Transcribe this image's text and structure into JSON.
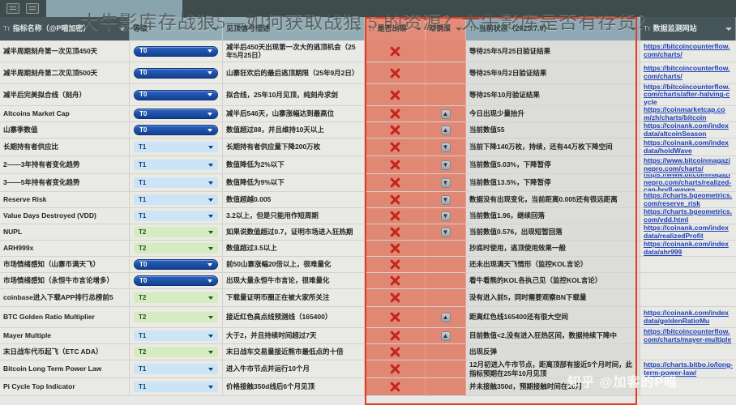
{
  "overlay_title": "大牛影库存战狼5—如何获取战狼 5 的资源？大牛影库是否有存货？",
  "watermark": "知乎 @加客的P喵",
  "toolbar": {
    "icon1": "table-icon",
    "icon2": "table-icon"
  },
  "header": [
    {
      "label": "指标名称（@P喵加密）",
      "type_glyph": "Tт"
    },
    {
      "label": "等级",
      "type_glyph": ""
    },
    {
      "label": "见顶信号描述",
      "type_glyph": ""
    },
    {
      "label": "是否出现",
      "type_glyph": "Tт"
    },
    {
      "label": "动销深",
      "type_glyph": ""
    },
    {
      "label": "当前状态（2025.7.9）",
      "type_glyph": "Tт"
    },
    {
      "label": "数据监测网站",
      "type_glyph": "Tт"
    }
  ],
  "rows": [
    {
      "name": "减半周期刻舟第一次见顶450天",
      "tier": "T0",
      "desc": "减半后450天出现第一次大的逃顶机会（25年5月25日）",
      "signal": "x",
      "trend": "",
      "current": "等待25年5月25日验证结果",
      "url": "https://bitcoincounterflow.com/charts/"
    },
    {
      "name": "减半周期刻舟第二次见顶500天",
      "tier": "T0",
      "desc": "山寨狂欢后的最后逃顶期限（25年9月2日）",
      "signal": "x",
      "trend": "",
      "current": "等待25年9月2日验证结果",
      "url": "https://bitcoincounterflow.com/charts/"
    },
    {
      "name": "减半后完美拟合线（刻舟）",
      "tier": "T0",
      "desc": "拟合线，25年10月见顶，纯刻舟求剑",
      "signal": "x",
      "trend": "",
      "current": "等待25年10月验证结果",
      "url": "https://bitcoincounterflow.com/charts/after-halving-cycle"
    },
    {
      "name": "Altcoins Market Cap",
      "tier": "T0",
      "desc": "减半后546天，山寨涨幅达到最高位",
      "signal": "x",
      "trend": "up",
      "current": "今日出现少量抬升",
      "url": "https://coinmarketcap.com/zh/charts/bitcoin"
    },
    {
      "name": "山寨季数值",
      "tier": "T0",
      "desc": "数值超过88，并且维持10天以上",
      "signal": "x",
      "trend": "up",
      "current": "当前数值55",
      "url": "https://coinank.com/indexdata/altcoinSeason"
    },
    {
      "name": "长期持有者供应比",
      "tier": "T1",
      "desc": "长期持有者供应量下降200万枚",
      "signal": "x",
      "trend": "down",
      "current": "当前下降140万枚，持续，还有44万枚下降空间",
      "url": "https://coinank.com/indexdata/holdWave"
    },
    {
      "name": "2——3年持有者变化趋势",
      "tier": "T1",
      "desc": "数值降低为2%以下",
      "signal": "x",
      "trend": "down",
      "current": "当前数值5.03%，下降暂停",
      "url": "https://www.bitcoinmagazinepro.com/charts/"
    },
    {
      "name": "3——5年持有者变化趋势",
      "tier": "T1",
      "desc": "数值降低为9%以下",
      "signal": "x",
      "trend": "down",
      "current": "当前数值13.5%，下降暂停",
      "url": "https://www.bitcoinmagazinepro.com/charts/realized-cap-hodl-waves"
    },
    {
      "name": "Reserve Risk",
      "tier": "T1",
      "desc": "数值超越0.005",
      "signal": "x",
      "trend": "down",
      "current": "数据没有出现变化，当前距离0.005还有很远距离",
      "url": "https://charts.bgeometrics.com/reserve_risk"
    },
    {
      "name": "Value Days Destroyed (VDD)",
      "tier": "T1",
      "desc": "3.2以上，但是只能用作短周期",
      "signal": "x",
      "trend": "down",
      "current": "当前数值1.96，继续回落",
      "url": "https://charts.bgeometrics.com/vdd.html"
    },
    {
      "name": "NUPL",
      "tier": "T2",
      "desc": "如果说数值超过0.7，证明市场进入狂热期",
      "signal": "x",
      "trend": "down",
      "current": "当前数值0.576，出现短暂回落",
      "url": "https://coinank.com/indexdata/realizedProfit"
    },
    {
      "name": "ARH999x",
      "tier": "T2",
      "desc": "数值超过3.5以上",
      "signal": "x",
      "trend": "",
      "current": "抄底时使用，逃顶使用效果一般",
      "url": "https://coinank.com/indexdata/ahr999"
    },
    {
      "name": "市场情绪感知（山寨币满天飞）",
      "tier": "T0",
      "desc": "前50山寨涨幅20倍以上，很难量化",
      "signal": "x",
      "trend": "",
      "current": "还未出现满天飞情形（监控KOL言论）",
      "url": ""
    },
    {
      "name": "市场情绪感知（永恒牛市言论增多）",
      "tier": "T0",
      "desc": "出现大量永恒牛市言论，很难量化",
      "signal": "x",
      "trend": "",
      "current": "看牛看熊的KOL各执己见（监控KOL言论）",
      "url": ""
    },
    {
      "name": "coinbase进入下载APP排行总榜前5",
      "tier": "T2",
      "desc": "下载量证明币圈正在被大家所关注",
      "signal": "x",
      "trend": "",
      "current": "没有进入前5，同时需要观察BN下载量",
      "url": ""
    },
    {
      "name": "BTC Golden Ratio Multiplier",
      "tier": "T2",
      "desc": "接近红色高点线预测线（165400）",
      "signal": "x",
      "trend": "up",
      "current": "距离红色线165400还有很大空间",
      "url": "https://coinank.com/indexdata/goldenRatioMu"
    },
    {
      "name": "Mayer Multiple",
      "tier": "T1",
      "desc": "大于2，并且持续时间超过7天",
      "signal": "x",
      "trend": "up",
      "current": "目前数值<2,没有进入狂热区间，数据持续下降中",
      "url": "https://bitcoincounterflow.com/charts/mayer-multiple"
    },
    {
      "name": "末日战车代币起飞（ETC ADA）",
      "tier": "T2",
      "desc": "末日战车交易量接近熊市最低点的十倍",
      "signal": "x",
      "trend": "",
      "current": "出现反弹",
      "url": ""
    },
    {
      "name": "Bitcoin Long Term Power Law",
      "tier": "T1",
      "desc": "进入牛市节点并运行10个月",
      "signal": "x",
      "trend": "",
      "current": "12月初进入牛市节点，距离顶部有接近5个月时间，此指标预期在25年10月见顶",
      "url": "https://charts.bitbo.io/long-term-power-law/"
    },
    {
      "name": "Pi Cycle Top Indicator",
      "tier": "T1",
      "desc": "价格接触350d线后6个月见顶",
      "signal": "x",
      "trend": "",
      "current": "并未接触350d，预期接触时间在10月",
      "url": ""
    }
  ],
  "colors": {
    "signal_bg": "#e08873",
    "x_red": "#c4251c",
    "t0_blue": "#12408f",
    "t1_blue": "#cce5f6",
    "t2_green": "#d5ecc2",
    "link_blue": "#1d3fb5",
    "selection_red": "#e03c22"
  }
}
